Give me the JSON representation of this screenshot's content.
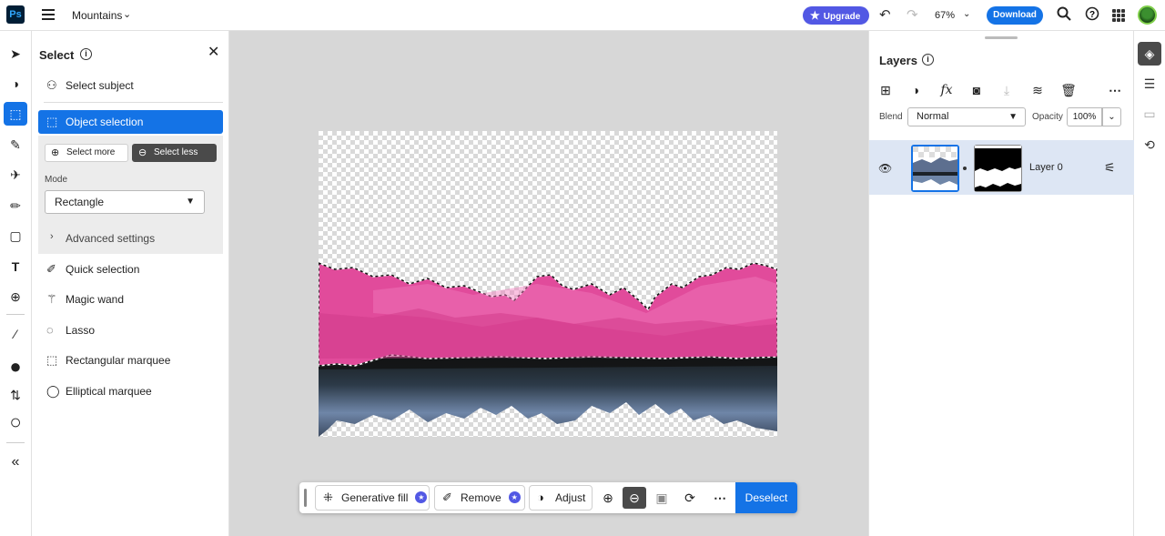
{
  "app": {
    "logo_text": "Ps",
    "document_title": "Mountains"
  },
  "topbar": {
    "upgrade_label": "Upgrade",
    "zoom": "67%",
    "download_label": "Download"
  },
  "tools": [
    {
      "name": "move-tool-icon",
      "glyph": "➤"
    },
    {
      "name": "adjust-tool-icon",
      "glyph": "◑"
    },
    {
      "name": "object-selection-tool-icon",
      "glyph": "⬚",
      "active": true
    },
    {
      "name": "healing-brush-tool-icon",
      "glyph": "✎"
    },
    {
      "name": "generative-tool-icon",
      "glyph": "✈"
    },
    {
      "name": "brush-tool-icon",
      "glyph": "✏"
    },
    {
      "name": "rectangle-tool-icon",
      "glyph": "▢"
    },
    {
      "name": "type-tool-icon",
      "glyph": "T"
    },
    {
      "name": "add-image-tool-icon",
      "glyph": "⊕"
    },
    {
      "name": "eyedropper-tool-icon",
      "glyph": "⁄"
    },
    {
      "name": "foreground-color-icon",
      "glyph": "●"
    },
    {
      "name": "swap-colors-icon",
      "glyph": "⇅"
    },
    {
      "name": "background-color-icon",
      "glyph": "○"
    },
    {
      "name": "collapse-toolbar-icon",
      "glyph": "«"
    }
  ],
  "select_panel": {
    "title": "Select",
    "items": [
      {
        "label": "Select subject",
        "icon": "👤"
      },
      {
        "label": "Object selection",
        "icon": "⬚",
        "active": true
      },
      {
        "label": "Quick selection",
        "icon": "✐"
      },
      {
        "label": "Magic wand",
        "icon": "✧"
      },
      {
        "label": "Lasso",
        "icon": "◌"
      },
      {
        "label": "Rectangular marquee",
        "icon": "⬚"
      },
      {
        "label": "Elliptical marquee",
        "icon": "◯"
      }
    ],
    "select_more_label": "Select more",
    "select_less_label": "Select less",
    "mode_label": "Mode",
    "mode_value": "Rectangle",
    "advanced_label": "Advanced settings"
  },
  "taskbar": {
    "generative_fill_label": "Generative fill",
    "remove_label": "Remove",
    "adjust_label": "Adjust",
    "deselect_label": "Deselect"
  },
  "layers_panel": {
    "title": "Layers",
    "blend_label": "Blend",
    "blend_value": "Normal",
    "opacity_label": "Opacity",
    "opacity_value": "100%",
    "layers": [
      {
        "name": "Layer 0"
      }
    ]
  },
  "colors": {
    "accent": "#1473e6",
    "upgrade": "#5258e4",
    "selection_overlay": "#e14b9b"
  }
}
